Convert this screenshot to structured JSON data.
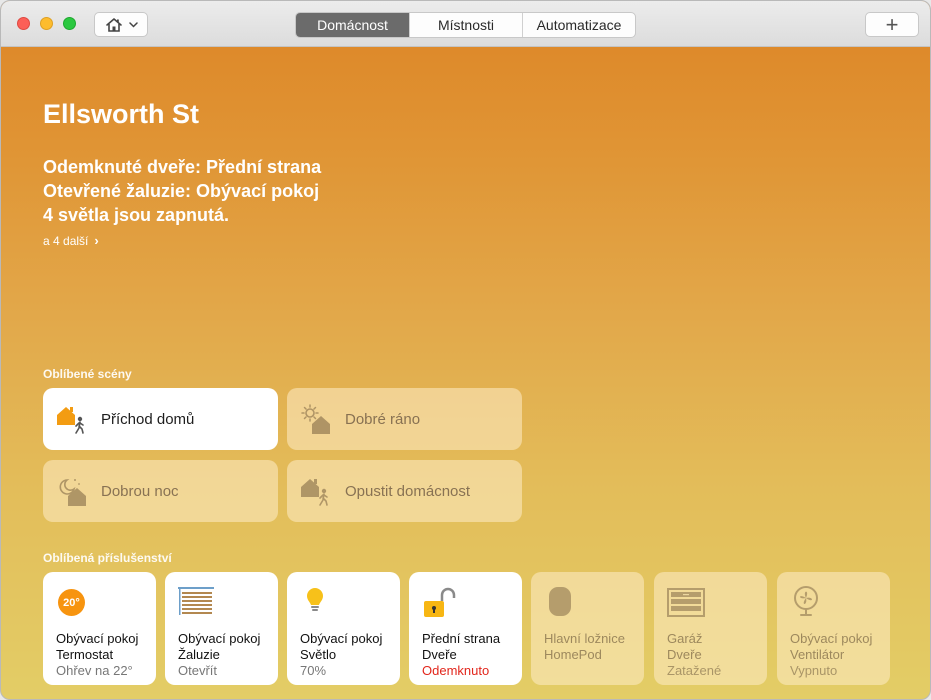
{
  "toolbar": {
    "tabs": [
      {
        "label": "Domácnost",
        "active": true
      },
      {
        "label": "Místnosti",
        "active": false
      },
      {
        "label": "Automatizace",
        "active": false
      }
    ],
    "add_label": "+"
  },
  "home": {
    "title": "Ellsworth St",
    "status": [
      "Odemknuté dveře: Přední strana",
      "Otevřené žaluzie: Obývací pokoj",
      "4 světla jsou zapnutá."
    ],
    "more_link": "a 4 další",
    "more_chevron": "›"
  },
  "scenes": {
    "label": "Oblíbené scény",
    "items": [
      {
        "label": "Příchod domů",
        "icon": "arrive-home-icon",
        "active": true
      },
      {
        "label": "Dobré ráno",
        "icon": "good-morning-icon",
        "active": false
      },
      {
        "label": "Dobrou noc",
        "icon": "good-night-icon",
        "active": false
      },
      {
        "label": "Opustit domácnost",
        "icon": "leave-home-icon",
        "active": false
      }
    ]
  },
  "accessories": {
    "label": "Oblíbená příslušenství",
    "items": [
      {
        "room": "Obývací pokoj",
        "name": "Termostat",
        "state": "Ohřev na 22°",
        "icon": "thermostat-icon",
        "icon_text": "20°",
        "active": true
      },
      {
        "room": "Obývací pokoj",
        "name": "Žaluzie",
        "state": "Otevřít",
        "icon": "blinds-icon",
        "active": true
      },
      {
        "room": "Obývací pokoj",
        "name": "Světlo",
        "state": "70%",
        "icon": "lightbulb-icon",
        "active": true
      },
      {
        "room": "Přední strana",
        "name": "Dveře",
        "state": "Odemknuto",
        "icon": "unlocked-icon",
        "active": true,
        "alert": true
      },
      {
        "room": "Hlavní ložnice",
        "name": "HomePod",
        "state": "",
        "icon": "homepod-icon",
        "active": false
      },
      {
        "room": "Garáž",
        "name": "Dveře",
        "state": "Zatažené",
        "icon": "garage-door-icon",
        "active": false
      },
      {
        "room": "Obývací pokoj",
        "name": "Ventilátor",
        "state": "Vypnuto",
        "icon": "fan-icon",
        "active": false
      }
    ]
  },
  "colors": {
    "accent_orange": "#f39c12",
    "alert_red": "#e2261c",
    "active_segment": "#6b6b6b"
  }
}
